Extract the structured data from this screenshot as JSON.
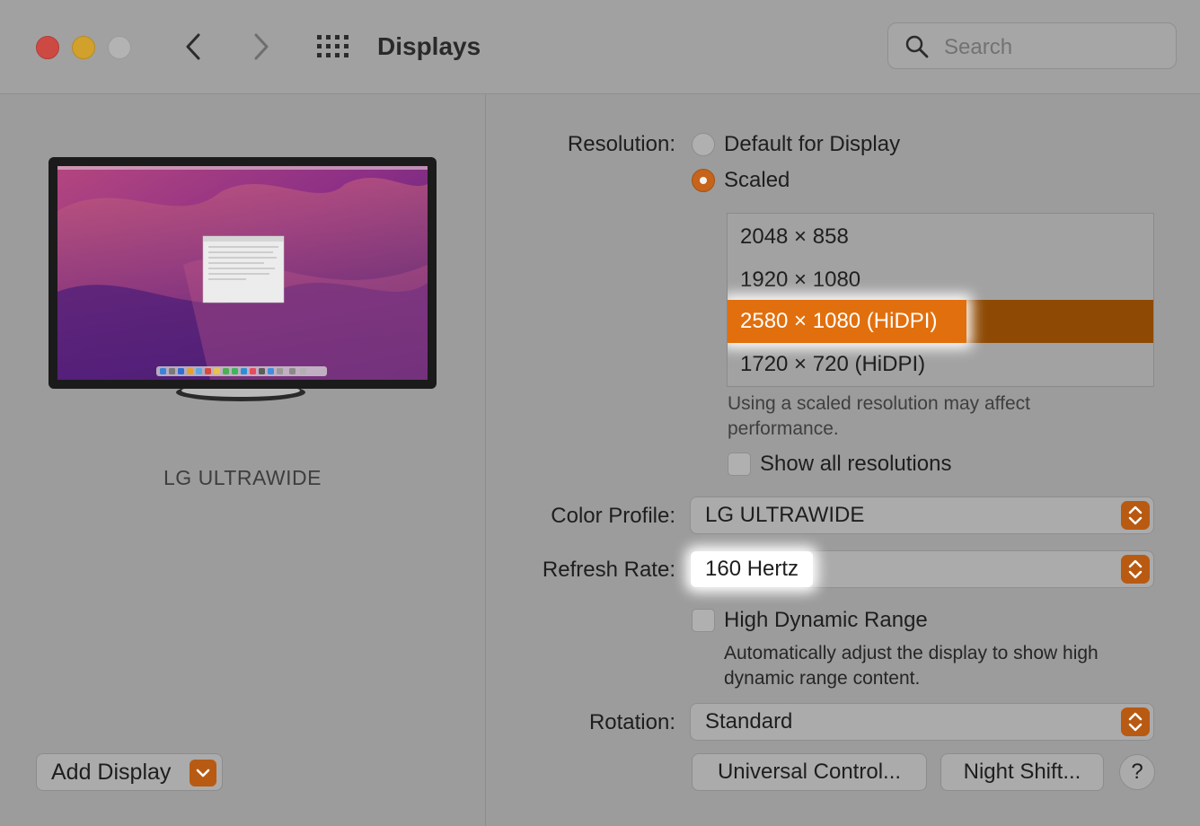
{
  "window": {
    "title": "Displays",
    "search_placeholder": "Search"
  },
  "left": {
    "display_name": "LG ULTRAWIDE",
    "add_display_label": "Add Display"
  },
  "resolution": {
    "label": "Resolution:",
    "options": [
      "Default for Display",
      "Scaled"
    ],
    "selected_option": "Scaled",
    "list": [
      "2048 × 858",
      "1920 × 1080",
      "2580 × 1080 (HiDPI)",
      "1720 × 720 (HiDPI)"
    ],
    "selected_resolution": "2580 × 1080 (HiDPI)",
    "note_line1": "Using a scaled resolution may affect",
    "note_line2": "performance.",
    "show_all_label": "Show all resolutions",
    "show_all_checked": false
  },
  "color_profile": {
    "label": "Color Profile:",
    "value": "LG ULTRAWIDE"
  },
  "refresh_rate": {
    "label": "Refresh Rate:",
    "value": "160 Hertz"
  },
  "hdr": {
    "label": "High Dynamic Range",
    "checked": false,
    "note_line1": "Automatically adjust the display to show high",
    "note_line2": "dynamic range content."
  },
  "rotation": {
    "label": "Rotation:",
    "value": "Standard"
  },
  "buttons": {
    "universal_control": "Universal Control...",
    "night_shift": "Night Shift...",
    "help": "?"
  },
  "colors": {
    "accent": "#e26f0d",
    "accent_dark": "#b85a12"
  }
}
